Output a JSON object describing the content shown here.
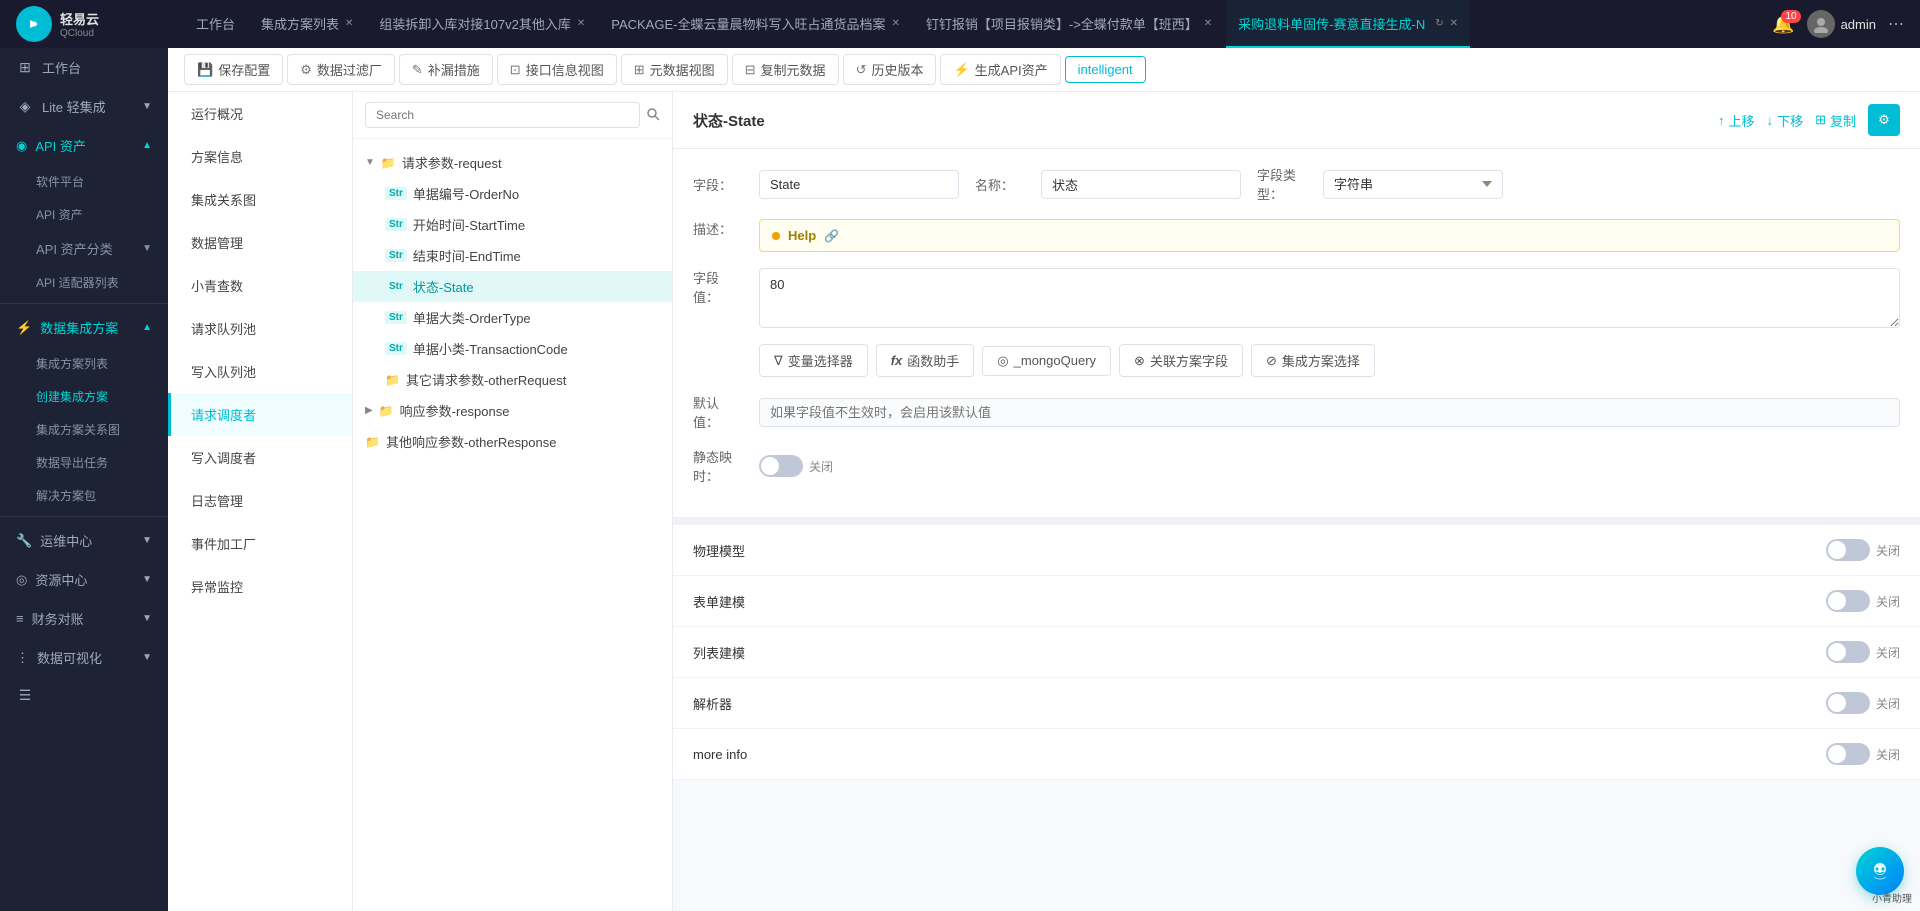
{
  "app": {
    "logo_text": "轻易云",
    "logo_sub": "QCloud"
  },
  "topbar": {
    "tabs": [
      {
        "id": "workbench",
        "label": "工作台",
        "closable": false,
        "active": false
      },
      {
        "id": "solution-list",
        "label": "集成方案列表",
        "closable": true,
        "active": false
      },
      {
        "id": "unpack-tab",
        "label": "组装拆卸入库对接107v2其他入库",
        "closable": true,
        "active": false
      },
      {
        "id": "package-tab",
        "label": "PACKAGE-全蝶云量晨物料写入旺占通货品档案",
        "closable": true,
        "active": false
      },
      {
        "id": "nail-tab",
        "label": "钉钉报销【项目报销类】->全蝶付款单【班西】",
        "closable": true,
        "active": false
      },
      {
        "id": "purchase-tab",
        "label": "采购退料单固传-赛意直接生成-N",
        "closable": true,
        "active": true
      }
    ],
    "notification_count": "10",
    "user_name": "admin",
    "more_label": "···"
  },
  "sidebar": {
    "items": [
      {
        "id": "workbench",
        "icon": "⊞",
        "label": "工作台",
        "active": false,
        "expandable": false
      },
      {
        "id": "lite",
        "icon": "◈",
        "label": "Lite 轻集成",
        "active": false,
        "expandable": true
      },
      {
        "id": "api-assets",
        "icon": "◉",
        "label": "API 资产",
        "active": true,
        "expandable": true
      },
      {
        "id": "software-platform",
        "icon": "",
        "label": "软件平台",
        "sub": true,
        "active": false
      },
      {
        "id": "api-asset-mgmt",
        "icon": "",
        "label": "API 资产",
        "sub": true,
        "active": false
      },
      {
        "id": "api-asset-classify",
        "icon": "",
        "label": "API 资产分类",
        "sub": true,
        "active": false,
        "expandable": true
      },
      {
        "id": "api-adapter",
        "icon": "",
        "label": "API 适配器列表",
        "sub": true,
        "active": false
      },
      {
        "id": "data-integration",
        "icon": "⚡",
        "label": "数据集成方案",
        "active": true,
        "expandable": true
      },
      {
        "id": "solution-list-nav",
        "icon": "",
        "label": "集成方案列表",
        "sub": true,
        "active": false
      },
      {
        "id": "create-solution",
        "icon": "",
        "label": "创建集成方案",
        "sub": true,
        "active": true
      },
      {
        "id": "solution-relation",
        "icon": "",
        "label": "集成方案关系图",
        "sub": true,
        "active": false
      },
      {
        "id": "data-export",
        "icon": "",
        "label": "数据导出任务",
        "sub": true,
        "active": false
      },
      {
        "id": "solution-package",
        "icon": "",
        "label": "解决方案包",
        "sub": true,
        "active": false
      },
      {
        "id": "ops-center",
        "icon": "🔧",
        "label": "运维中心",
        "active": false,
        "expandable": true
      },
      {
        "id": "resource-center",
        "icon": "◎",
        "label": "资源中心",
        "active": false,
        "expandable": true
      },
      {
        "id": "finance",
        "icon": "≡",
        "label": "财务对账",
        "active": false,
        "expandable": true
      },
      {
        "id": "data-viz",
        "icon": "⋮",
        "label": "数据可视化",
        "active": false,
        "expandable": true
      }
    ]
  },
  "toolbar": {
    "buttons": [
      {
        "id": "save-config",
        "icon": "💾",
        "label": "保存配置"
      },
      {
        "id": "data-filter",
        "icon": "⚙",
        "label": "数据过滤厂"
      },
      {
        "id": "fill-measure",
        "icon": "✎",
        "label": "补漏措施"
      },
      {
        "id": "interface-view",
        "icon": "⊡",
        "label": "接口信息视图"
      },
      {
        "id": "meta-view",
        "icon": "⊞",
        "label": "元数据视图"
      },
      {
        "id": "copy-data",
        "icon": "⊟",
        "label": "复制元数据"
      },
      {
        "id": "history",
        "icon": "↺",
        "label": "历史版本"
      },
      {
        "id": "gen-api",
        "icon": "⚡",
        "label": "生成API资产"
      },
      {
        "id": "intelligent",
        "label": "intelligent"
      }
    ]
  },
  "left_nav": {
    "items": [
      {
        "id": "run-overview",
        "label": "运行概况",
        "active": false
      },
      {
        "id": "solution-info",
        "label": "方案信息",
        "active": false
      },
      {
        "id": "integration-map",
        "label": "集成关系图",
        "active": false
      },
      {
        "id": "data-mgmt",
        "label": "数据管理",
        "active": false
      },
      {
        "id": "small-query",
        "label": "小青查数",
        "active": false
      },
      {
        "id": "request-queue",
        "label": "请求队列池",
        "active": false
      },
      {
        "id": "write-queue",
        "label": "写入队列池",
        "active": false
      },
      {
        "id": "request-debugger",
        "label": "请求调度者",
        "active": true
      },
      {
        "id": "write-debugger",
        "label": "写入调度者",
        "active": false
      },
      {
        "id": "log-mgmt",
        "label": "日志管理",
        "active": false
      },
      {
        "id": "event-factory",
        "label": "事件加工厂",
        "active": false
      },
      {
        "id": "anomaly-monitor",
        "label": "异常监控",
        "active": false
      }
    ]
  },
  "tree": {
    "search_placeholder": "Search",
    "nodes": [
      {
        "id": "request-params",
        "type": "folder",
        "label": "请求参数-request",
        "expanded": true,
        "children": [
          {
            "id": "order-no",
            "type": "Str",
            "label": "单据编号-OrderNo"
          },
          {
            "id": "start-time",
            "type": "Str",
            "label": "开始时间-StartTime"
          },
          {
            "id": "end-time",
            "type": "Str",
            "label": "结束时间-EndTime"
          },
          {
            "id": "state",
            "type": "Str",
            "label": "状态-State",
            "active": true
          },
          {
            "id": "order-type",
            "type": "Str",
            "label": "单据大类-OrderType"
          },
          {
            "id": "transaction-code",
            "type": "Str",
            "label": "单据小类-TransactionCode"
          },
          {
            "id": "other-request",
            "type": "folder",
            "label": "其它请求参数-otherRequest"
          }
        ]
      },
      {
        "id": "response-params",
        "type": "folder",
        "label": "响应参数-response",
        "expanded": false
      },
      {
        "id": "other-response",
        "type": "folder",
        "label": "其他响应参数-otherResponse",
        "expanded": false
      }
    ]
  },
  "detail": {
    "title": "状态-State",
    "actions": {
      "up_label": "上移",
      "down_label": "下移",
      "copy_label": "复制"
    },
    "field_label": "字段：",
    "field_value": "State",
    "name_label": "名称：",
    "name_value": "状态",
    "type_label": "字段类型：",
    "type_value": "字符串",
    "desc_label": "描述：",
    "help_label": "Help",
    "field_value_label": "字段值：",
    "field_value_content": "80",
    "action_buttons": [
      {
        "id": "var-selector",
        "icon": "∇",
        "label": "变量选择器"
      },
      {
        "id": "func-helper",
        "icon": "fx",
        "label": "函数助手"
      },
      {
        "id": "mongo-query",
        "icon": "◎",
        "label": "_mongoQuery"
      },
      {
        "id": "link-field",
        "icon": "⊗",
        "label": "关联方案字段"
      },
      {
        "id": "solution-select",
        "icon": "⊘",
        "label": "集成方案选择"
      }
    ],
    "default_label": "默认值：",
    "default_placeholder": "如果字段值不生效时，会启用该默认值",
    "static_map_label": "静态映时：",
    "static_map_off": "关闭",
    "sections": [
      {
        "id": "physical-model",
        "label": "物理模型",
        "toggle": "关闭"
      },
      {
        "id": "form-model",
        "label": "表单建模",
        "toggle": "关闭"
      },
      {
        "id": "list-model",
        "label": "列表建模",
        "toggle": "关闭"
      },
      {
        "id": "parser",
        "label": "解析器",
        "toggle": "关闭"
      },
      {
        "id": "more-info",
        "label": "more info",
        "toggle": "关闭"
      }
    ]
  },
  "chatbot": {
    "label": "小青助理"
  },
  "colors": {
    "primary": "#00bcd4",
    "active_bg": "#e0f8f8",
    "active_text": "#009999",
    "sidebar_bg": "#1e2235",
    "topbar_bg": "#1a1a2e"
  }
}
